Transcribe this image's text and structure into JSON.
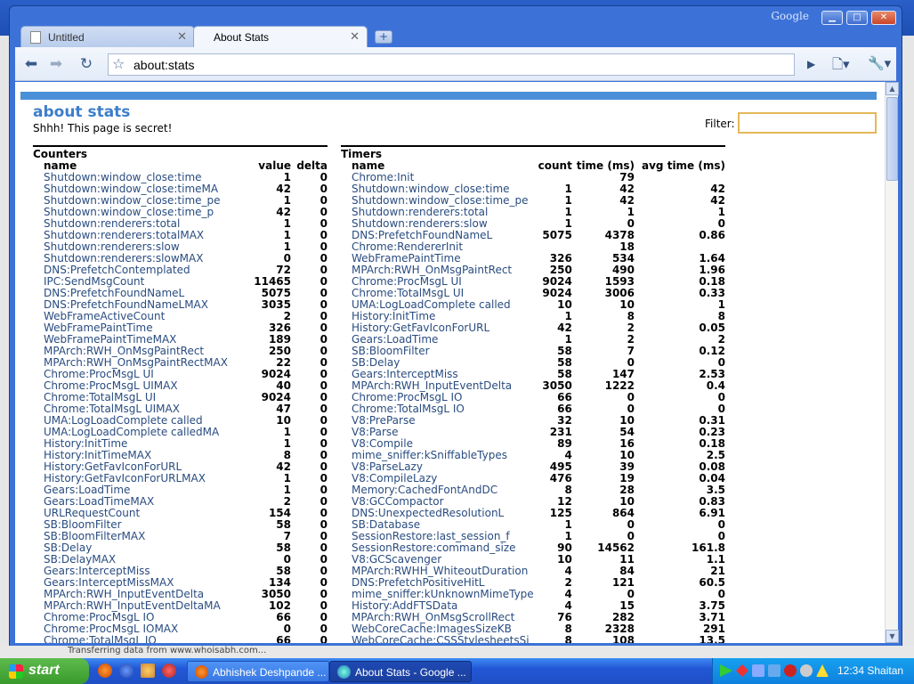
{
  "browser": {
    "brand": "Google",
    "tabs": [
      {
        "label": "Untitled",
        "active": false
      },
      {
        "label": "About Stats",
        "active": true
      }
    ],
    "url": "about:stats",
    "window_buttons": {
      "minimize": "▁",
      "maximize": "□",
      "close": "✕"
    }
  },
  "page": {
    "title": "about stats",
    "subtitle": "Shhh! This page is secret!",
    "filter_label": "Filter:",
    "filter_value": "",
    "accent_color": "#4a90d9"
  },
  "counters": {
    "title": "Counters",
    "columns": [
      "name",
      "value",
      "delta"
    ],
    "rows": [
      [
        "Shutdown:window_close:time",
        "1",
        "0"
      ],
      [
        "Shutdown:window_close:timeMA",
        "42",
        "0"
      ],
      [
        "Shutdown:window_close:time_pe",
        "1",
        "0"
      ],
      [
        "Shutdown:window_close:time_p",
        "42",
        "0"
      ],
      [
        "Shutdown:renderers:total",
        "1",
        "0"
      ],
      [
        "Shutdown:renderers:totalMAX",
        "1",
        "0"
      ],
      [
        "Shutdown:renderers:slow",
        "1",
        "0"
      ],
      [
        "Shutdown:renderers:slowMAX",
        "0",
        "0"
      ],
      [
        "DNS:PrefetchContemplated",
        "72",
        "0"
      ],
      [
        "IPC:SendMsgCount",
        "11465",
        "0"
      ],
      [
        "DNS:PrefetchFoundNameL",
        "5075",
        "0"
      ],
      [
        "DNS:PrefetchFoundNameLMAX",
        "3035",
        "0"
      ],
      [
        "WebFrameActiveCount",
        "2",
        "0"
      ],
      [
        "WebFramePaintTime",
        "326",
        "0"
      ],
      [
        "WebFramePaintTimeMAX",
        "189",
        "0"
      ],
      [
        "MPArch:RWH_OnMsgPaintRect",
        "250",
        "0"
      ],
      [
        "MPArch:RWH_OnMsgPaintRectMAX",
        "22",
        "0"
      ],
      [
        "Chrome:ProcMsgL UI",
        "9024",
        "0"
      ],
      [
        "Chrome:ProcMsgL UIMAX",
        "40",
        "0"
      ],
      [
        "Chrome:TotalMsgL UI",
        "9024",
        "0"
      ],
      [
        "Chrome:TotalMsgL UIMAX",
        "47",
        "0"
      ],
      [
        "UMA:LogLoadComplete called",
        "10",
        "0"
      ],
      [
        "UMA:LogLoadComplete calledMA",
        "1",
        "0"
      ],
      [
        "History:InitTime",
        "1",
        "0"
      ],
      [
        "History:InitTimeMAX",
        "8",
        "0"
      ],
      [
        "History:GetFavIconForURL",
        "42",
        "0"
      ],
      [
        "History:GetFavIconForURLMAX",
        "1",
        "0"
      ],
      [
        "Gears:LoadTime",
        "1",
        "0"
      ],
      [
        "Gears:LoadTimeMAX",
        "2",
        "0"
      ],
      [
        "URLRequestCount",
        "154",
        "0"
      ],
      [
        "SB:BloomFilter",
        "58",
        "0"
      ],
      [
        "SB:BloomFilterMAX",
        "7",
        "0"
      ],
      [
        "SB:Delay",
        "58",
        "0"
      ],
      [
        "SB:DelayMAX",
        "0",
        "0"
      ],
      [
        "Gears:InterceptMiss",
        "58",
        "0"
      ],
      [
        "Gears:InterceptMissMAX",
        "134",
        "0"
      ],
      [
        "MPArch:RWH_InputEventDelta",
        "3050",
        "0"
      ],
      [
        "MPArch:RWH_InputEventDeltaMA",
        "102",
        "0"
      ],
      [
        "Chrome:ProcMsgL IO",
        "66",
        "0"
      ],
      [
        "Chrome:ProcMsgL IOMAX",
        "0",
        "0"
      ],
      [
        "Chrome:TotalMsgL IO",
        "66",
        "0"
      ]
    ]
  },
  "timers": {
    "title": "Timers",
    "columns": [
      "name",
      "count",
      "time (ms)",
      "avg time (ms)"
    ],
    "rows": [
      [
        "Chrome:Init",
        "",
        "79",
        ""
      ],
      [
        "Shutdown:window_close:time",
        "1",
        "42",
        "42"
      ],
      [
        "Shutdown:window_close:time_pe",
        "1",
        "42",
        "42"
      ],
      [
        "Shutdown:renderers:total",
        "1",
        "1",
        "1"
      ],
      [
        "Shutdown:renderers:slow",
        "1",
        "0",
        "0"
      ],
      [
        "DNS:PrefetchFoundNameL",
        "5075",
        "4378",
        "0.86"
      ],
      [
        "Chrome:RendererInit",
        "",
        "18",
        ""
      ],
      [
        "WebFramePaintTime",
        "326",
        "534",
        "1.64"
      ],
      [
        "MPArch:RWH_OnMsgPaintRect",
        "250",
        "490",
        "1.96"
      ],
      [
        "Chrome:ProcMsgL UI",
        "9024",
        "1593",
        "0.18"
      ],
      [
        "Chrome:TotalMsgL UI",
        "9024",
        "3006",
        "0.33"
      ],
      [
        "UMA:LogLoadComplete called",
        "10",
        "10",
        "1"
      ],
      [
        "History:InitTime",
        "1",
        "8",
        "8"
      ],
      [
        "History:GetFavIconForURL",
        "42",
        "2",
        "0.05"
      ],
      [
        "Gears:LoadTime",
        "1",
        "2",
        "2"
      ],
      [
        "SB:BloomFilter",
        "58",
        "7",
        "0.12"
      ],
      [
        "SB:Delay",
        "58",
        "0",
        "0"
      ],
      [
        "Gears:InterceptMiss",
        "58",
        "147",
        "2.53"
      ],
      [
        "MPArch:RWH_InputEventDelta",
        "3050",
        "1222",
        "0.4"
      ],
      [
        "Chrome:ProcMsgL IO",
        "66",
        "0",
        "0"
      ],
      [
        "Chrome:TotalMsgL IO",
        "66",
        "0",
        "0"
      ],
      [
        "V8:PreParse",
        "32",
        "10",
        "0.31"
      ],
      [
        "V8:Parse",
        "231",
        "54",
        "0.23"
      ],
      [
        "V8:Compile",
        "89",
        "16",
        "0.18"
      ],
      [
        "mime_sniffer:kSniffableTypes",
        "4",
        "10",
        "2.5"
      ],
      [
        "V8:ParseLazy",
        "495",
        "39",
        "0.08"
      ],
      [
        "V8:CompileLazy",
        "476",
        "19",
        "0.04"
      ],
      [
        "Memory:CachedFontAndDC",
        "8",
        "28",
        "3.5"
      ],
      [
        "V8:GCCompactor",
        "12",
        "10",
        "0.83"
      ],
      [
        "DNS:UnexpectedResolutionL",
        "125",
        "864",
        "6.91"
      ],
      [
        "SB:Database",
        "1",
        "0",
        "0"
      ],
      [
        "SessionRestore:last_session_f",
        "1",
        "0",
        "0"
      ],
      [
        "SessionRestore:command_size",
        "90",
        "14562",
        "161.8"
      ],
      [
        "V8:GCScavenger",
        "10",
        "11",
        "1.1"
      ],
      [
        "MPArch:RWHH_WhiteoutDuration",
        "4",
        "84",
        "21"
      ],
      [
        "DNS:PrefetchPositiveHitL",
        "2",
        "121",
        "60.5"
      ],
      [
        "mime_sniffer:kUnknownMimeType",
        "4",
        "0",
        "0"
      ],
      [
        "History:AddFTSData",
        "4",
        "15",
        "3.75"
      ],
      [
        "MPArch:RWH_OnMsgScrollRect",
        "76",
        "282",
        "3.71"
      ],
      [
        "WebCoreCache:ImagesSizeKB",
        "8",
        "2328",
        "291"
      ],
      [
        "WebCoreCache:CSSStylesheetsSi",
        "8",
        "108",
        "13.5"
      ]
    ]
  },
  "status_strip": {
    "text": "Transferring data from www.whoisabh.com..."
  },
  "taskbar": {
    "start_label": "start",
    "tasks": [
      {
        "label": "Abhishek Deshpande ..."
      },
      {
        "label": "About Stats - Google ..."
      }
    ],
    "clock": "12:34 Shaitan"
  }
}
